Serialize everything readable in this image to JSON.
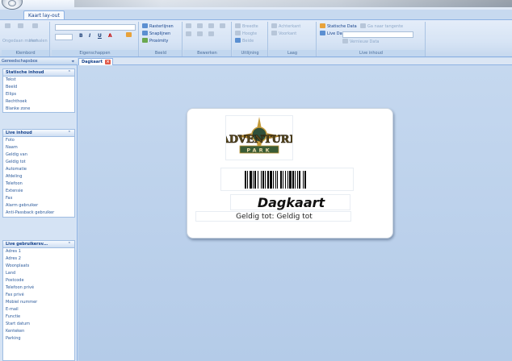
{
  "app": {
    "ribbon_tab": "Kaart lay-out",
    "orb_icon": "office-orb-icon"
  },
  "ribbon": {
    "groups": [
      {
        "caption": "Klembord"
      },
      {
        "caption": "Eigenschappen"
      },
      {
        "caption": "Beeld"
      },
      {
        "caption": "Bewerken"
      },
      {
        "caption": "Uitlijning"
      },
      {
        "caption": "Laag"
      },
      {
        "caption": "Live inhoud"
      }
    ],
    "clipboard": {
      "paste_label": "Ongedaan maken",
      "redo_label": "Herhalen"
    },
    "format_buttons": [
      "B",
      "I",
      "U",
      "A"
    ],
    "view": {
      "gridlines": "Rasterlijnen",
      "snaplines": "Snaplijnen",
      "proximity": "Proximity"
    },
    "align": {
      "width": "Breedte",
      "height": "Hoogte",
      "size": "Beide"
    },
    "layer": {
      "back": "Achterkant",
      "front": "Voorkant"
    },
    "live": {
      "static": "Statische Data",
      "live": "Live Data",
      "records": "Ga naar tangente",
      "refresh": "Vernieuw Data"
    }
  },
  "panel": {
    "title": "Gereedschapsbox",
    "sections": [
      {
        "title": "Statische inhoud",
        "items": [
          "Tekst",
          "Beeld",
          "Ellips",
          "Rechthoek",
          "Blanke zone"
        ]
      },
      {
        "title": "Live inhoud",
        "items": [
          "Foto",
          "Naam",
          "Geldig van",
          "Geldig tot",
          "Automatie",
          "Afdeling",
          "Telefoon",
          "Extensie",
          "Fax",
          "Alarm gebruiker",
          "Anti-Passback gebruiker"
        ]
      },
      {
        "title": "Live gebruikersv...",
        "items": [
          "Adres 1",
          "Adres 2",
          "Woonplaats",
          "Land",
          "Postcode",
          "Telefoon privé",
          "Fax privé",
          "Mobiel nummer",
          "E-mail",
          "Functie",
          "Start datum",
          "Kenteken",
          "Parking"
        ]
      }
    ]
  },
  "document": {
    "tab_label": "Dagkaart"
  },
  "card": {
    "logo_text": "ADVENTURE",
    "logo_sub": "PARK",
    "title": "Dagkaart",
    "valid_label": "Geldig tot:",
    "valid_value": "Geldig tot"
  },
  "colors": {
    "ribbon_bg": "#d7e4f5",
    "canvas_bg": "#bed3ec",
    "accent": "#15428b",
    "tab_close": "#e05a4a"
  }
}
